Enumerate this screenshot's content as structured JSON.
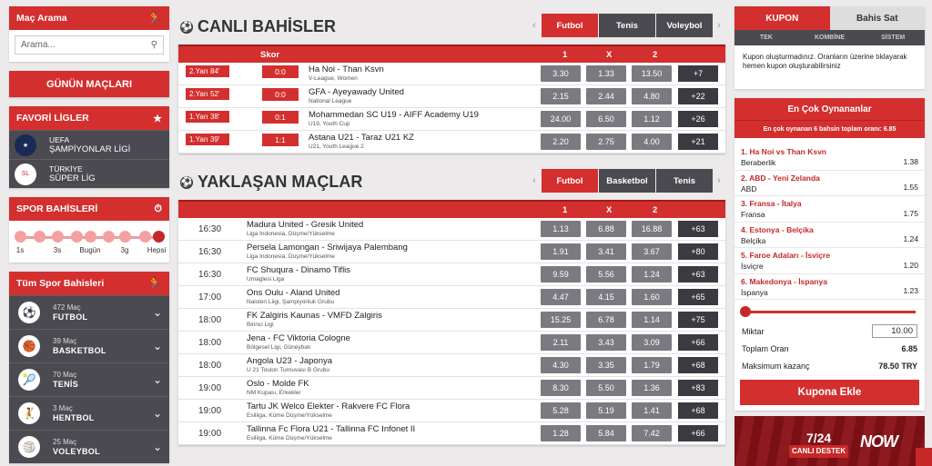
{
  "search": {
    "title": "Maç Arama",
    "placeholder": "Arama..."
  },
  "todays_matches": "GÜNÜN MAÇLARI",
  "favorites": {
    "title": "FAVORİ LİGLER",
    "items": [
      {
        "line1": "UEFA",
        "line2": "ŞAMPİYONLAR LİGİ"
      },
      {
        "line1": "TÜRKİYE",
        "line2": "SÜPER LİG"
      }
    ]
  },
  "sport_bets": {
    "title": "SPOR BAHİSLERİ",
    "labels": [
      "1s",
      "3s",
      "Bugün",
      "3g",
      "Hepsi"
    ]
  },
  "all_sports": {
    "title": "Tüm Spor Bahisleri",
    "items": [
      {
        "count": "472 Maç",
        "name": "FUTBOL"
      },
      {
        "count": "39 Maç",
        "name": "BASKETBOL"
      },
      {
        "count": "70 Maç",
        "name": "TENİS"
      },
      {
        "count": "3 Maç",
        "name": "HENTBOL"
      },
      {
        "count": "25 Maç",
        "name": "VOLEYBOL"
      }
    ]
  },
  "live": {
    "title": "CANLI BAHİSLER",
    "tabs": [
      "Futbol",
      "Tenis",
      "Voleybol"
    ],
    "head": {
      "score": "Skor",
      "c1": "1",
      "cx": "X",
      "c2": "2"
    },
    "rows": [
      {
        "time": "2.Yarı 84'",
        "score": "0:0",
        "match": "Ha Noi - Than Ksvn",
        "league": "V-League, Women",
        "o1": "3.30",
        "ox": "1.33",
        "o2": "13.50",
        "more": "+7"
      },
      {
        "time": "2.Yarı 52'",
        "score": "0:0",
        "match": "GFA - Ayeyawady United",
        "league": "National League",
        "o1": "2.15",
        "ox": "2.44",
        "o2": "4.80",
        "more": "+22"
      },
      {
        "time": "1.Yarı 38'",
        "score": "0:1",
        "match": "Mohammedan SC U19 - AIFF Academy U19",
        "league": "U19, Youth Cup",
        "o1": "24.00",
        "ox": "6.50",
        "o2": "1.12",
        "more": "+26"
      },
      {
        "time": "1.Yarı 39'",
        "score": "1:1",
        "match": "Astana U21 - Taraz U21 KZ",
        "league": "U21, Youth League 2",
        "o1": "2.20",
        "ox": "2.75",
        "o2": "4.00",
        "more": "+21"
      }
    ]
  },
  "upcoming": {
    "title": "YAKLAŞAN MAÇLAR",
    "tabs": [
      "Futbol",
      "Basketbol",
      "Tenis"
    ],
    "head": {
      "c1": "1",
      "cx": "X",
      "c2": "2"
    },
    "rows": [
      {
        "time": "16:30",
        "match": "Madura United - Gresik United",
        "league": "Liga Indonesia, Düşme/Yükselme",
        "o1": "1.13",
        "ox": "6.88",
        "o2": "16.88",
        "more": "+63"
      },
      {
        "time": "16:30",
        "match": "Persela Lamongan - Sriwijaya Palembang",
        "league": "Liga Indonesia, Düşme/Yükselme",
        "o1": "1.91",
        "ox": "3.41",
        "o2": "3.67",
        "more": "+80"
      },
      {
        "time": "16:30",
        "match": "FC Shuqura - Dinamo Tiflis",
        "league": "Umaglesi Liga",
        "o1": "9.59",
        "ox": "5.56",
        "o2": "1.24",
        "more": "+63"
      },
      {
        "time": "17:00",
        "match": "Ons Oulu - Aland United",
        "league": "Naisten Liigi, Şampiyonluk Grubu",
        "o1": "4.47",
        "ox": "4.15",
        "o2": "1.60",
        "more": "+65"
      },
      {
        "time": "18:00",
        "match": "FK Zalgiris Kaunas - VMFD Zalgiris",
        "league": "Birinci Ligi",
        "o1": "15.25",
        "ox": "6.78",
        "o2": "1.14",
        "more": "+75"
      },
      {
        "time": "18:00",
        "match": "Jena - FC Viktoria Cologne",
        "league": "Bölgesel Ligi, Güneybatı",
        "o1": "2.11",
        "ox": "3.43",
        "o2": "3.09",
        "more": "+66"
      },
      {
        "time": "18:00",
        "match": "Angola U23 - Japonya",
        "league": "U 21 Toulon Turnuvası B Grubu",
        "o1": "4.30",
        "ox": "3.35",
        "o2": "1.79",
        "more": "+68"
      },
      {
        "time": "19:00",
        "match": "Oslo - Molde FK",
        "league": "NM Kupası, Erkekler",
        "o1": "8.30",
        "ox": "5.50",
        "o2": "1.36",
        "more": "+83"
      },
      {
        "time": "19:00",
        "match": "Tartu JK Welco Elekter - Rakvere FC Flora",
        "league": "Esiliiga, Küme Düşme/Yükselme",
        "o1": "5.28",
        "ox": "5.19",
        "o2": "1.41",
        "more": "+68"
      },
      {
        "time": "19:00",
        "match": "Tallinna Fc Flora U21 - Tallinna FC Infonet II",
        "league": "Esiliiga, Küme Düşme/Yükselme",
        "o1": "1.28",
        "ox": "5.84",
        "o2": "7.42",
        "more": "+66"
      }
    ]
  },
  "coupon": {
    "tab_active": "KUPON",
    "tab_other": "Bahis Sat",
    "sub": [
      "TEK",
      "KOMBİNE",
      "SİSTEM"
    ],
    "message": "Kupon oluşturmadınız. Oranların üzerine tıklayarak hemen kupon oluşturabilirsiniz"
  },
  "most_played": {
    "title": "En Çok Oynananlar",
    "subtitle": "En çok oynanan 6 bahsin toplam oranı: 6.85",
    "items": [
      {
        "match": "1. Ha Noi vs Than Ksvn",
        "pick": "Beraberlik",
        "odd": "1.38"
      },
      {
        "match": "2. ABD - Yeni Zelanda",
        "pick": "ABD",
        "odd": "1.55"
      },
      {
        "match": "3. Fransa - İtalya",
        "pick": "Fransa",
        "odd": "1.75"
      },
      {
        "match": "4. Estonya - Belçika",
        "pick": "Belçika",
        "odd": "1.24"
      },
      {
        "match": "5. Faroe Adaları - İsviçre",
        "pick": "İsviçre",
        "odd": "1.20"
      },
      {
        "match": "6. Makedonya - İspanya",
        "pick": "İspanya",
        "odd": "1.23"
      }
    ]
  },
  "calc": {
    "amount_label": "Miktar",
    "amount": "10.00",
    "total_label": "Toplam Oran",
    "total": "6.85",
    "max_label": "Maksimum kazanç",
    "max": "78.50 TRY",
    "button": "Kupona Ekle"
  },
  "banner": {
    "title": "7/24",
    "sub": "CANLI DESTEK",
    "brand": "NOW"
  }
}
